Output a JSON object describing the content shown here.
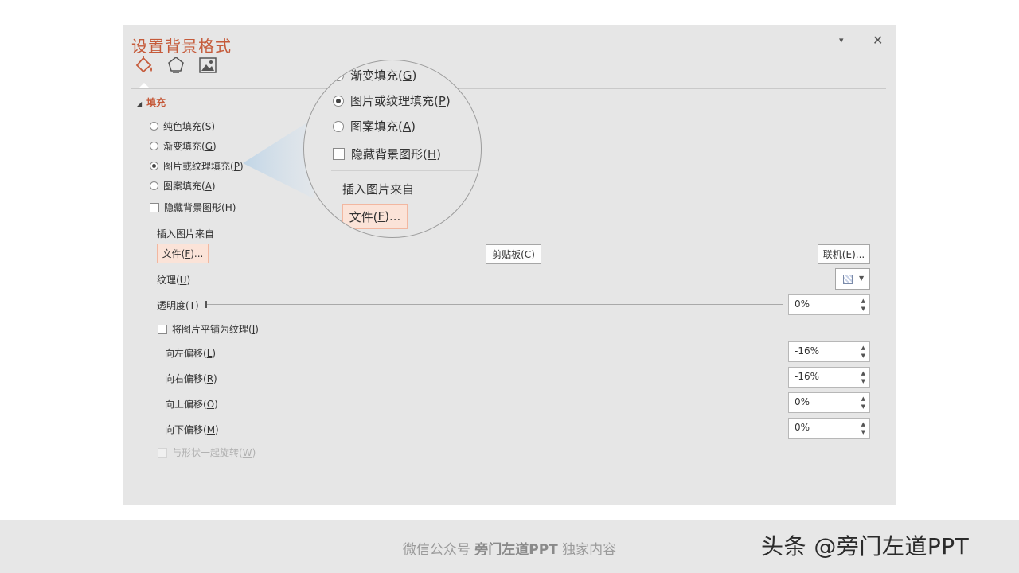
{
  "pane": {
    "title": "设置背景格式",
    "dropdown_glyph": "▾",
    "close_glyph": "✕",
    "tabs": [
      {
        "icon": "paint-bucket-icon"
      },
      {
        "icon": "pentagon-icon"
      },
      {
        "icon": "picture-icon"
      }
    ],
    "section": {
      "label": "填充"
    },
    "fill_options": [
      {
        "text": "纯色填充(",
        "key": "S",
        "selected": false
      },
      {
        "text": "渐变填充(",
        "key": "G",
        "selected": false
      },
      {
        "text": "图片或纹理填充(",
        "key": "P",
        "selected": true
      },
      {
        "text": "图案填充(",
        "key": "A",
        "selected": false
      }
    ],
    "hide_bg": {
      "text": "隐藏背景图形(",
      "key": "H",
      "checked": false
    },
    "insert_from": "插入图片来自",
    "buttons": {
      "file": {
        "text": "文件(",
        "key": "F",
        "tail": ")..."
      },
      "clipboard": {
        "text": "剪贴板(",
        "key": "C",
        "tail": ")"
      },
      "online": {
        "text": "联机(",
        "key": "E",
        "tail": ")..."
      }
    },
    "texture": {
      "text": "纹理(",
      "key": "U"
    },
    "transparency": {
      "text": "透明度(",
      "key": "T",
      "value": "0%",
      "level": 0
    },
    "tile": {
      "text": "将图片平铺为纹理(",
      "key": "I",
      "checked": false
    },
    "offsets": [
      {
        "text": "向左偏移(",
        "key": "L",
        "value": "-16%"
      },
      {
        "text": "向右偏移(",
        "key": "R",
        "value": "-16%"
      },
      {
        "text": "向上偏移(",
        "key": "O",
        "value": "0%"
      },
      {
        "text": "向下偏移(",
        "key": "M",
        "value": "0%"
      }
    ],
    "rotate": {
      "text": "与形状一起旋转(",
      "key": "W",
      "disabled": true
    }
  },
  "magnifier": {
    "opt_gradient": {
      "text": "渐变填充(",
      "key": "G"
    },
    "opt_picture": {
      "text": "图片或纹理填充(",
      "key": "P"
    },
    "opt_pattern": {
      "text": "图案填充(",
      "key": "A"
    },
    "hide_bg": {
      "text": "隐藏背景图形(",
      "key": "H"
    },
    "insert_from": "插入图片来自",
    "file": {
      "text": "文件(",
      "key": "F",
      "tail": ")..."
    }
  },
  "footer": {
    "prefix": "微信公众号 ",
    "brand": "旁门左道PPT",
    "suffix": " 独家内容",
    "watermark": "头条 @旁门左道PPT"
  },
  "colors": {
    "accent": "#c55a3a",
    "panel_bg": "#e6e6e6",
    "button_highlight": "#fbe3d8"
  }
}
